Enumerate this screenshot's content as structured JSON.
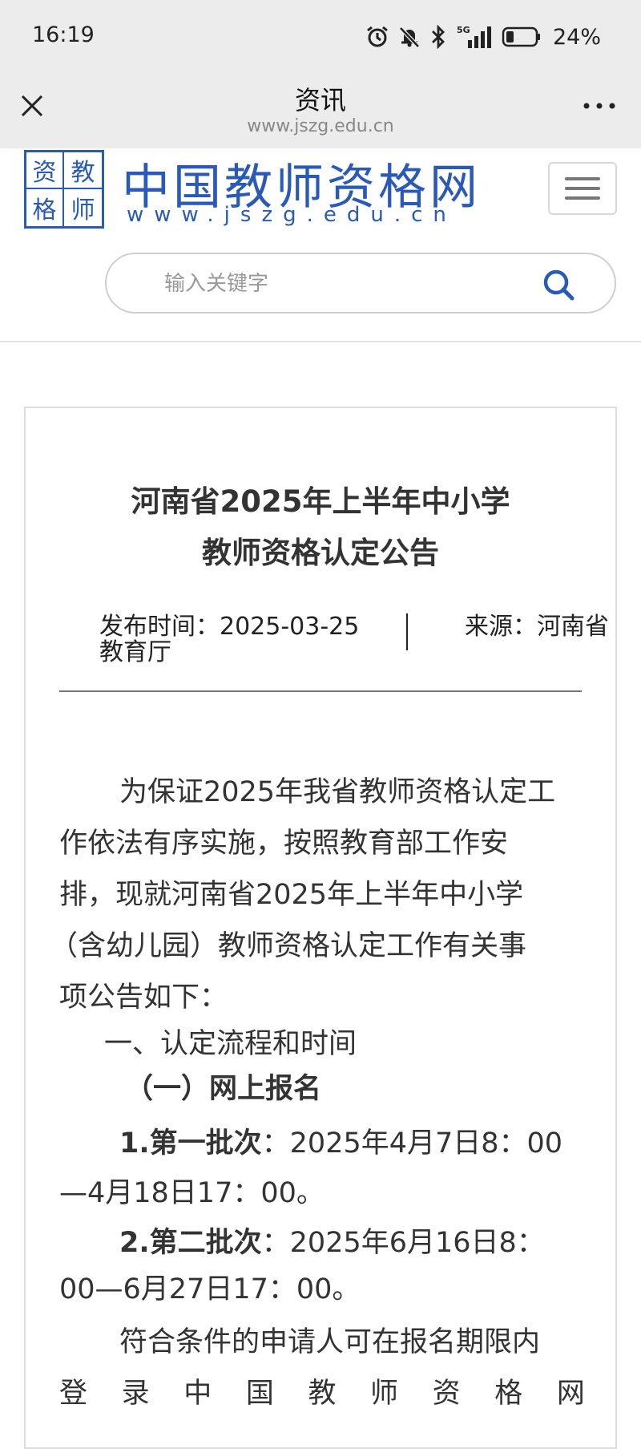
{
  "status_bar": {
    "time": "16:19",
    "battery": "24%",
    "icons": [
      "alarm-icon",
      "mute-icon",
      "bluetooth-icon",
      "5g-signal-icon",
      "battery-icon"
    ]
  },
  "nav_bar": {
    "title": "资讯",
    "url": "www.jszg.edu.cn",
    "icons": [
      "close-icon",
      "more-icon"
    ]
  },
  "site": {
    "logo_chars": [
      "资",
      "教",
      "格",
      "师"
    ],
    "name": "中国教师资格网",
    "domain": "www.jszg.edu.cn",
    "search_placeholder": "输入关键字",
    "accent_color": "#2a5ab8"
  },
  "article": {
    "title_line1": "河南省2025年上半年中小学",
    "title_line2": "教师资格认定公告",
    "publish_label": "发布时间：2025-03-25",
    "source_label": "来源：河南省",
    "source_label_cont": "教育厅",
    "p1": [
      "为保证2025年我省教师资格认定工",
      "作依法有序实施，按照教育部工作安",
      "排，现就河南省2025年上半年中小学",
      "（含幼儿园）教师资格认定工作有关事",
      "项公告如下："
    ],
    "section1": "一、认定流程和时间",
    "sub1": "（一）网上报名",
    "batch1_label": "1.第一批次",
    "batch1_text": "：2025年4月7日8：00",
    "batch1_cont": "—4月18日17：00。",
    "batch2_label": "2.第二批次",
    "batch2_text": "：2025年6月16日8：",
    "batch2_cont": "00—6月27日17：00。",
    "p2_line1": "符合条件的申请人可在报名期限内",
    "p2_line2_chars": [
      "登",
      "录",
      "中",
      "国",
      "教",
      "师",
      "资",
      "格",
      "网"
    ]
  }
}
